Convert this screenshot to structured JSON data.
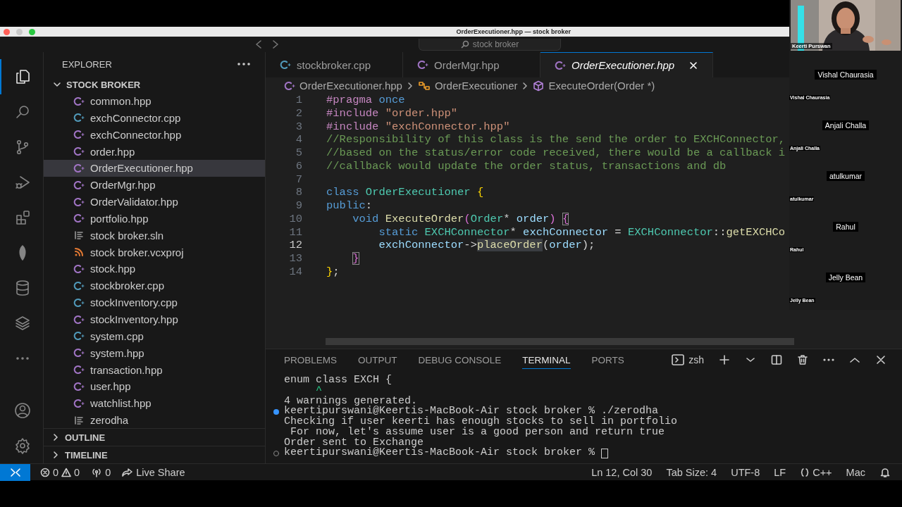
{
  "window": {
    "title": "OrderExecutioner.hpp — stock broker",
    "command_center": "stock broker"
  },
  "activity_bar": {
    "top": [
      {
        "kind": "files",
        "selected": true
      },
      {
        "kind": "search",
        "selected": false
      },
      {
        "kind": "source-control",
        "selected": false
      },
      {
        "kind": "run-debug",
        "selected": false
      },
      {
        "kind": "extensions",
        "selected": false
      },
      {
        "kind": "leaf",
        "selected": false
      },
      {
        "kind": "database",
        "selected": false
      },
      {
        "kind": "layers",
        "selected": false
      },
      {
        "kind": "more",
        "selected": false
      }
    ],
    "bottom": [
      {
        "kind": "account",
        "selected": false
      },
      {
        "kind": "settings",
        "selected": false
      }
    ]
  },
  "explorer": {
    "title": "EXPLORER",
    "folder": {
      "name": "STOCK BROKER",
      "expanded": true,
      "files": [
        {
          "name": "common.hpp",
          "kind": "hpp",
          "selected": false
        },
        {
          "name": "exchConnector.cpp",
          "kind": "cpp",
          "selected": false
        },
        {
          "name": "exchConnector.hpp",
          "kind": "hpp",
          "selected": false
        },
        {
          "name": "order.hpp",
          "kind": "hpp",
          "selected": false
        },
        {
          "name": "OrderExecutioner.hpp",
          "kind": "hpp",
          "selected": true
        },
        {
          "name": "OrderMgr.hpp",
          "kind": "hpp",
          "selected": false
        },
        {
          "name": "OrderValidator.hpp",
          "kind": "hpp",
          "selected": false
        },
        {
          "name": "portfolio.hpp",
          "kind": "hpp",
          "selected": false
        },
        {
          "name": "stock broker.sln",
          "kind": "plain",
          "selected": false
        },
        {
          "name": "stock broker.vcxproj",
          "kind": "feed",
          "selected": false
        },
        {
          "name": "stock.hpp",
          "kind": "hpp",
          "selected": false
        },
        {
          "name": "stockbroker.cpp",
          "kind": "cpp",
          "selected": false
        },
        {
          "name": "stockInventory.cpp",
          "kind": "cpp",
          "selected": false
        },
        {
          "name": "stockInventory.hpp",
          "kind": "hpp",
          "selected": false
        },
        {
          "name": "system.cpp",
          "kind": "cpp",
          "selected": false
        },
        {
          "name": "system.hpp",
          "kind": "hpp",
          "selected": false
        },
        {
          "name": "transaction.hpp",
          "kind": "hpp",
          "selected": false
        },
        {
          "name": "user.hpp",
          "kind": "hpp",
          "selected": false
        },
        {
          "name": "watchlist.hpp",
          "kind": "hpp",
          "selected": false
        },
        {
          "name": "zerodha",
          "kind": "plain",
          "selected": false
        }
      ]
    },
    "sections": [
      {
        "name": "OUTLINE",
        "expanded": false
      },
      {
        "name": "TIMELINE",
        "expanded": false
      }
    ]
  },
  "editor": {
    "tabs": [
      {
        "label": "stockbroker.cpp",
        "kind": "cpp",
        "selected": false,
        "preview": false
      },
      {
        "label": "OrderMgr.hpp",
        "kind": "hpp",
        "selected": false,
        "preview": false
      },
      {
        "label": "OrderExecutioner.hpp",
        "kind": "hpp",
        "selected": true,
        "preview": true
      }
    ],
    "breadcrumbs": [
      {
        "kind": "file",
        "text": "OrderExecutioner.hpp"
      },
      {
        "kind": "class",
        "text": "OrderExecutioner"
      },
      {
        "kind": "method",
        "text": "ExecuteOrder(Order *)"
      }
    ],
    "lines": [
      {
        "number": "1",
        "active": false,
        "tokens": [
          {
            "kind": "pp",
            "text": "#pragma"
          },
          {
            "kind": "kw",
            "text": " once"
          }
        ]
      },
      {
        "number": "2",
        "active": false,
        "tokens": [
          {
            "kind": "pp",
            "text": "#include"
          },
          {
            "kind": "str",
            "text": " \"order.hpp\""
          }
        ]
      },
      {
        "number": "3",
        "active": false,
        "tokens": [
          {
            "kind": "pp",
            "text": "#include"
          },
          {
            "kind": "str",
            "text": " \"exchConnector.hpp\""
          }
        ]
      },
      {
        "number": "4",
        "active": false,
        "tokens": [
          {
            "kind": "cmt",
            "text": "//Responsibility of this class is the send the order to EXCHConnector,"
          }
        ]
      },
      {
        "number": "5",
        "active": false,
        "tokens": [
          {
            "kind": "cmt",
            "text": "//based on the status/error code received, there would be a callback i"
          }
        ]
      },
      {
        "number": "6",
        "active": false,
        "tokens": [
          {
            "kind": "cmt",
            "text": "//callback would update the order status, transactions and db"
          }
        ]
      },
      {
        "number": "7",
        "active": false
      },
      {
        "number": "8",
        "active": false,
        "tokens": [
          {
            "kind": "kw",
            "text": "class"
          },
          {
            "kind": "type",
            "text": " OrderExecutioner "
          },
          {
            "kind": "b1",
            "text": "{"
          }
        ]
      },
      {
        "number": "9",
        "active": false,
        "tokens": [
          {
            "kind": "kw",
            "text": "public"
          },
          {
            "kind": "op",
            "text": ":"
          }
        ]
      },
      {
        "number": "10",
        "active": false,
        "tokens": [
          {
            "kind": "kw",
            "text": "    void"
          },
          {
            "kind": "fn",
            "text": " ExecuteOrder"
          },
          {
            "kind": "b2",
            "text": "("
          },
          {
            "kind": "type",
            "text": "Order"
          },
          {
            "kind": "op",
            "text": "* "
          },
          {
            "kind": "var",
            "text": "order"
          },
          {
            "kind": "b2",
            "text": ") "
          },
          {
            "kind": "b2match",
            "text": "{"
          }
        ]
      },
      {
        "number": "11",
        "active": false,
        "tokens": [
          {
            "kind": "kw",
            "text": "        static"
          },
          {
            "kind": "type",
            "text": " EXCHConnector"
          },
          {
            "kind": "op",
            "text": "* "
          },
          {
            "kind": "var",
            "text": "exchConnector"
          },
          {
            "kind": "op",
            "text": " = "
          },
          {
            "kind": "type",
            "text": "EXCHConnector"
          },
          {
            "kind": "op",
            "text": "::"
          },
          {
            "kind": "fn",
            "text": "getEXCHCo"
          }
        ]
      },
      {
        "number": "12",
        "active": true,
        "tokens": [
          {
            "kind": "var",
            "text": "        exchConnector"
          },
          {
            "kind": "op",
            "text": "->"
          },
          {
            "kind": "fnsel",
            "text": "placeOrder"
          },
          {
            "kind": "op",
            "text": "("
          },
          {
            "kind": "var",
            "text": "order"
          },
          {
            "kind": "op",
            "text": ");"
          }
        ]
      },
      {
        "number": "13",
        "active": false,
        "tokens": [
          {
            "kind": "b2match",
            "text": "    }"
          }
        ]
      },
      {
        "number": "14",
        "active": false,
        "tokens": [
          {
            "kind": "b1",
            "text": "}"
          },
          {
            "kind": "op",
            "text": ";"
          }
        ]
      }
    ]
  },
  "panel": {
    "tabs": [
      {
        "label": "PROBLEMS",
        "selected": false
      },
      {
        "label": "OUTPUT",
        "selected": false
      },
      {
        "label": "DEBUG CONSOLE",
        "selected": false
      },
      {
        "label": "TERMINAL",
        "selected": true
      },
      {
        "label": "PORTS",
        "selected": false
      }
    ],
    "shell": "zsh",
    "terminal": [
      {
        "kind": "plain",
        "text": "enum class EXCH {"
      },
      {
        "kind": "caret",
        "text": "     ^"
      },
      {
        "kind": "plain",
        "text": "4 warnings generated."
      },
      {
        "kind": "run",
        "text": "keertipurswani@Keertis-MacBook-Air stock broker % ./zerodha"
      },
      {
        "kind": "plain",
        "text": "Checking if user keerti has enough stocks to sell in portfolio"
      },
      {
        "kind": "plain",
        "text": " For now, let's assume user is a good person and return true"
      },
      {
        "kind": "plain",
        "text": "Order sent to Exchange"
      },
      {
        "kind": "prompt",
        "text": "keertipurswani@Keertis-MacBook-Air stock broker %"
      }
    ]
  },
  "status_bar": {
    "left": [
      {
        "kind": "remote"
      },
      {
        "kind": "problems",
        "errors": "0",
        "warnings": "0"
      },
      {
        "kind": "ports",
        "text": "0"
      },
      {
        "kind": "liveshare",
        "text": "Live Share"
      }
    ],
    "right": [
      {
        "kind": "text",
        "text": "Ln 12, Col 30"
      },
      {
        "kind": "text",
        "text": "Tab Size: 4"
      },
      {
        "kind": "text",
        "text": "UTF-8"
      },
      {
        "kind": "text",
        "text": "LF"
      },
      {
        "kind": "language",
        "text": "C++"
      },
      {
        "kind": "text",
        "text": "Mac"
      },
      {
        "kind": "bell"
      }
    ]
  },
  "call": {
    "presenter": {
      "name": "Keerti Purswan",
      "kind": "picture"
    },
    "participants": [
      {
        "name": "Vishal Chaurasia",
        "label": "Vishal Chaurasia"
      },
      {
        "name": "Anjali Challa",
        "label": "Anjali Challa"
      },
      {
        "name": "atulkumar",
        "label": "atulkumar"
      },
      {
        "name": "Rahul",
        "label": "Rahul"
      },
      {
        "name": "Jelly Bean",
        "label": "Jelly Bean"
      }
    ]
  }
}
